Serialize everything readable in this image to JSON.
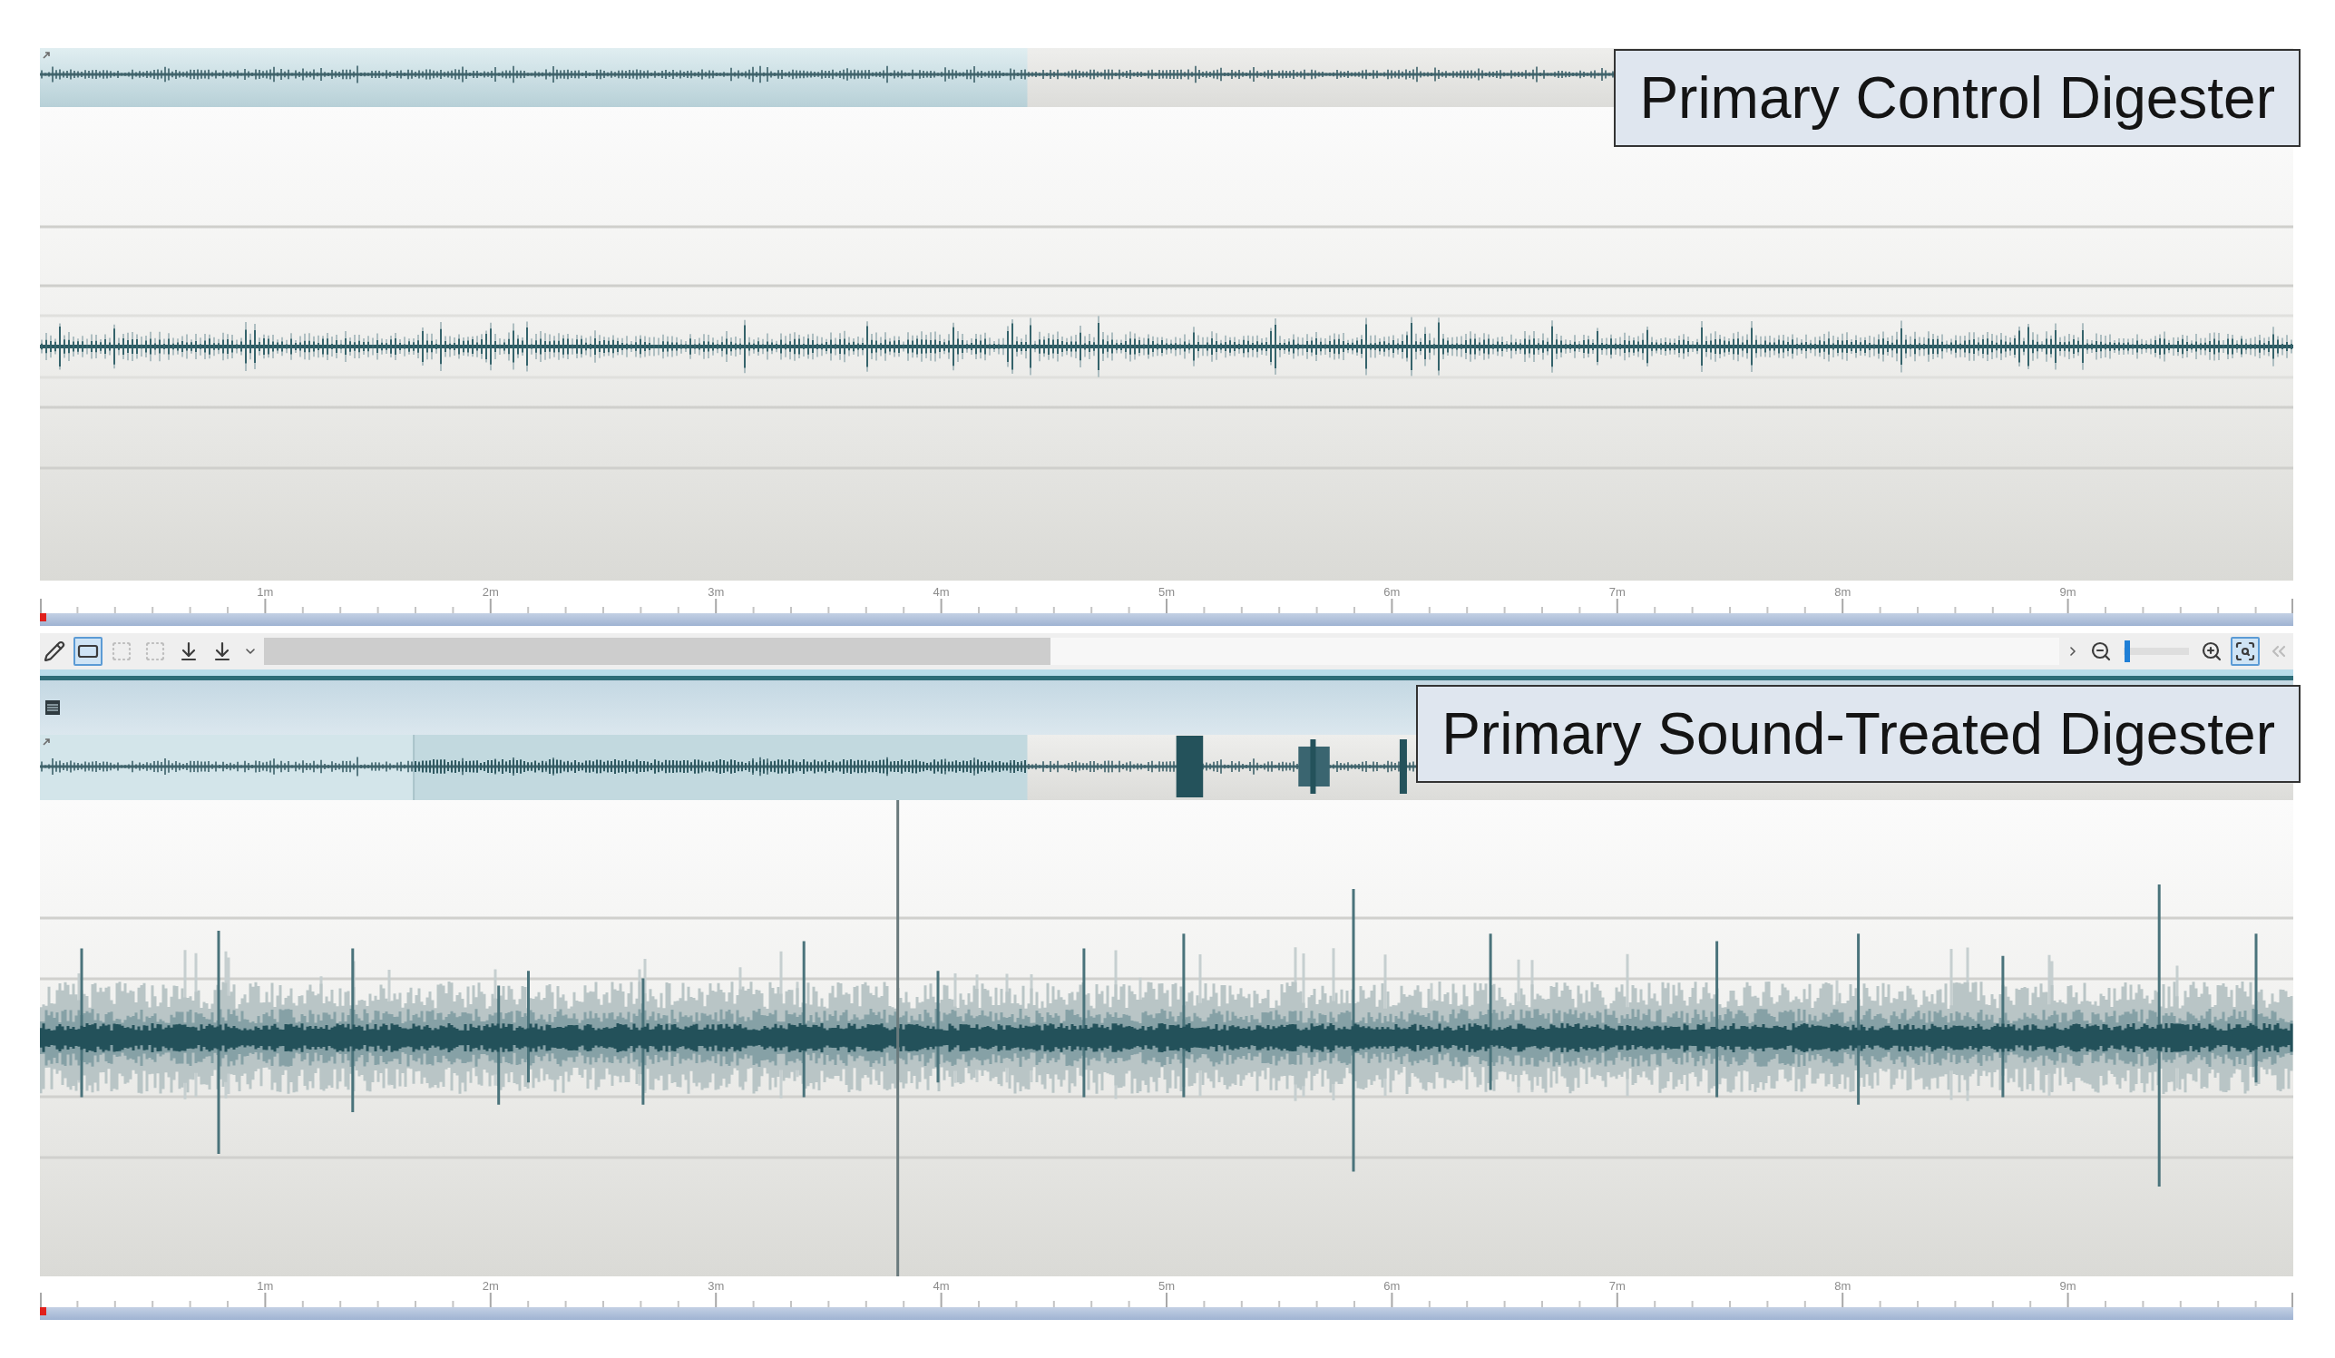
{
  "top_track": {
    "caption": "Primary Control Digester",
    "ruler_labels": [
      "1m",
      "2m",
      "3m",
      "4m",
      "5m",
      "6m",
      "7m",
      "8m",
      "9m"
    ]
  },
  "toolbar": {
    "tools": [
      {
        "selected": false,
        "disabled": false
      },
      {
        "selected": true,
        "disabled": false
      },
      {
        "selected": false,
        "disabled": true
      },
      {
        "selected": false,
        "disabled": true
      },
      {
        "selected": false,
        "disabled": false
      },
      {
        "selected": false,
        "disabled": false
      }
    ],
    "zoom_slider": {
      "level": 0.06
    },
    "view_tools": [
      {
        "selected": false,
        "disabled": false
      },
      {
        "selected": false,
        "disabled": false
      },
      {
        "selected": true,
        "disabled": false
      },
      {
        "selected": false,
        "disabled": true
      }
    ]
  },
  "bottom_track": {
    "caption": "Primary Sound-Treated Digester",
    "ruler_labels": [
      "1m",
      "2m",
      "3m",
      "4m",
      "5m",
      "6m",
      "7m",
      "8m",
      "9m"
    ]
  }
}
